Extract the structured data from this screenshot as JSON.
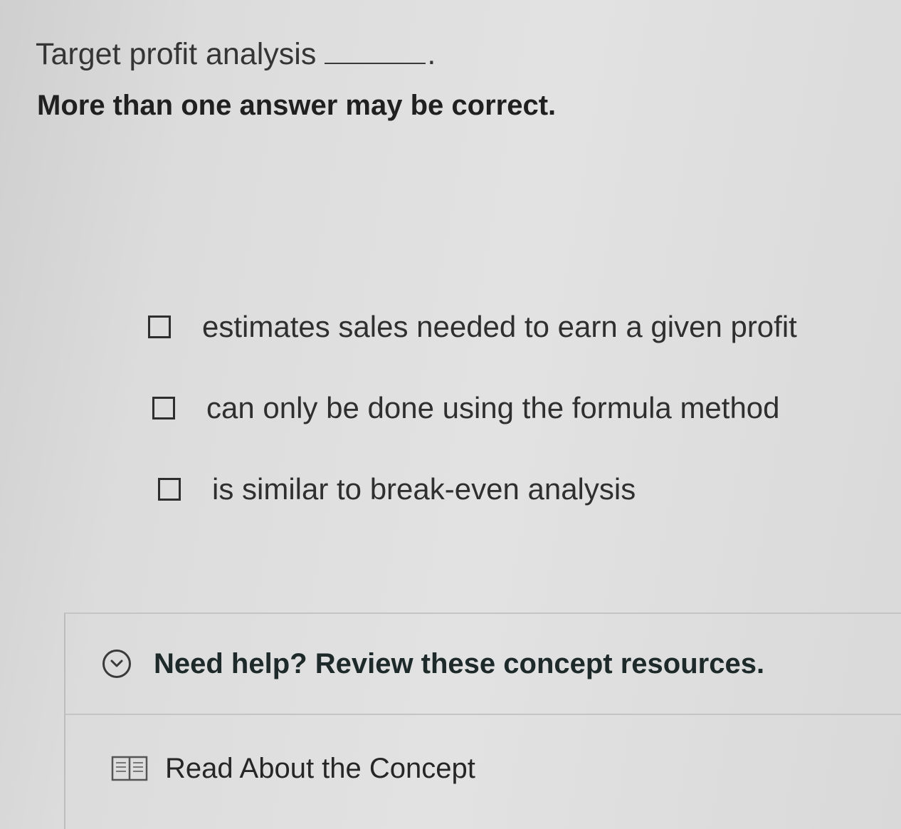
{
  "question": {
    "prompt": "Target profit analysis",
    "blank_suffix": ".",
    "instruction": "More than one answer may be correct."
  },
  "options": [
    {
      "label": "estimates sales needed to earn a given profit",
      "checked": false
    },
    {
      "label": "can only be done using the formula method",
      "checked": false
    },
    {
      "label": "is similar to break-even analysis",
      "checked": false
    }
  ],
  "help": {
    "title": "Need help? Review these concept resources.",
    "toggle_icon": "chevron-down-circle-icon",
    "resources": [
      {
        "label": "Read About the Concept",
        "icon": "book-icon"
      }
    ]
  }
}
